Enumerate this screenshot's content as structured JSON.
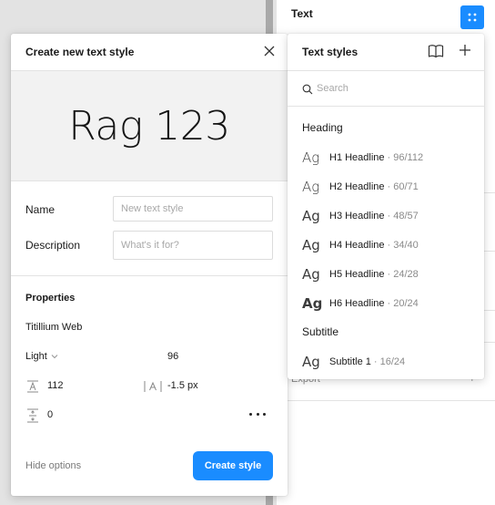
{
  "background": {
    "section_title": "Text",
    "export_label": "Export",
    "export_add": "+"
  },
  "dialog": {
    "title": "Create new text style",
    "preview_text": "Rag 123",
    "name_label": "Name",
    "name_placeholder": "New text style",
    "description_label": "Description",
    "description_placeholder": "What's it for?",
    "properties_title": "Properties",
    "font_family": "Titillium Web",
    "font_weight": "Light",
    "font_size": "96",
    "line_height": "112",
    "letter_spacing": "-1.5 px",
    "paragraph_spacing": "0",
    "hide_options_label": "Hide options",
    "create_button_label": "Create style"
  },
  "popover": {
    "title": "Text styles",
    "search_placeholder": "Search",
    "groups": [
      {
        "label": "Heading",
        "styles": [
          {
            "preview": "Ag",
            "name": "H1 Headline",
            "meta": "· 96/112",
            "weight": "300"
          },
          {
            "preview": "Ag",
            "name": "H2 Headline",
            "meta": "· 60/71",
            "weight": "300"
          },
          {
            "preview": "Ag",
            "name": "H3 Headline",
            "meta": "· 48/57",
            "weight": "400"
          },
          {
            "preview": "Ag",
            "name": "H4 Headline",
            "meta": "· 34/40",
            "weight": "400"
          },
          {
            "preview": "Ag",
            "name": "H5 Headline",
            "meta": "· 24/28",
            "weight": "400"
          },
          {
            "preview": "Ag",
            "name": "H6 Headline",
            "meta": "· 20/24",
            "weight": "700"
          }
        ]
      },
      {
        "label": "Subtitle",
        "styles": [
          {
            "preview": "Ag",
            "name": "Subtitle 1",
            "meta": "· 16/24",
            "weight": "400"
          }
        ]
      }
    ]
  },
  "colors": {
    "accent": "#1a8cff",
    "panel_bg": "#ffffff",
    "canvas_bg": "#e3e3e3",
    "preview_bg": "#f2f2f2"
  }
}
